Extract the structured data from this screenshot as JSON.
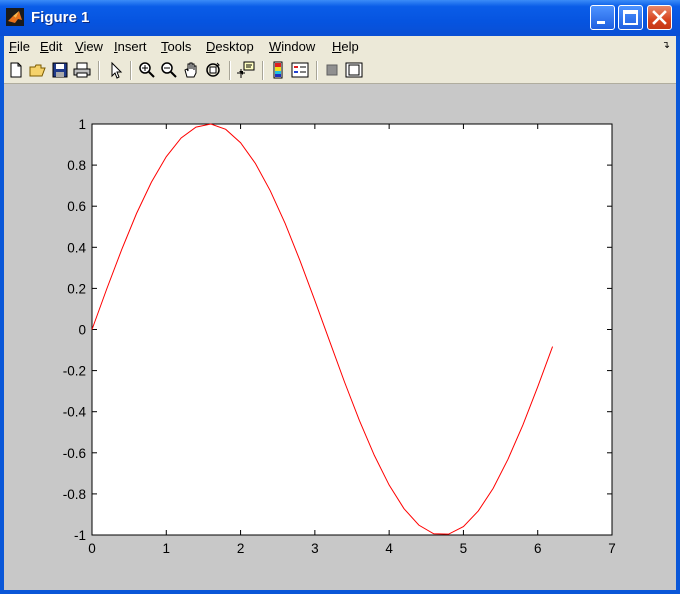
{
  "window": {
    "title": "Figure 1"
  },
  "menu": {
    "items": [
      "File",
      "Edit",
      "View",
      "Insert",
      "Tools",
      "Desktop",
      "Window",
      "Help"
    ],
    "shortcut_letters": [
      "F",
      "E",
      "V",
      "I",
      "T",
      "D",
      "W",
      "H"
    ]
  },
  "toolbar": {
    "buttons": [
      "new-figure-icon",
      "open-file-icon",
      "save-icon",
      "print-icon",
      "edit-plot-icon",
      "zoom-in-icon",
      "zoom-out-icon",
      "pan-icon",
      "rotate-3d-icon",
      "data-cursor-icon",
      "colorbar-icon",
      "legend-icon",
      "hide-plot-tools-icon",
      "show-plot-tools-icon"
    ]
  },
  "colors": {
    "line": "#ff0000",
    "figure_bg": "#c8c8c8",
    "axes_bg": "#ffffff",
    "title_bar": "#0a5de8"
  },
  "chart_data": {
    "type": "line",
    "title": "",
    "xlabel": "",
    "ylabel": "",
    "xlim": [
      0,
      7
    ],
    "ylim": [
      -1,
      1
    ],
    "xticks": [
      "0",
      "1",
      "2",
      "3",
      "4",
      "5",
      "6",
      "7"
    ],
    "yticks": [
      "1",
      "0.8",
      "0.6",
      "0.4",
      "0.2",
      "0",
      "-0.2",
      "-0.4",
      "-0.6",
      "-0.8",
      "-1"
    ],
    "grid": false,
    "series": [
      {
        "color": "#ff0000",
        "x": [
          0,
          0.2,
          0.4,
          0.6,
          0.8,
          1.0,
          1.2,
          1.4,
          1.6,
          1.8,
          2.0,
          2.2,
          2.4,
          2.6,
          2.8,
          3.0,
          3.2,
          3.4,
          3.6,
          3.8,
          4.0,
          4.2,
          4.4,
          4.6,
          4.8,
          5.0,
          5.2,
          5.4,
          5.6,
          5.8,
          6.0,
          6.2
        ],
        "y": [
          0,
          0.199,
          0.389,
          0.565,
          0.717,
          0.841,
          0.932,
          0.985,
          1.0,
          0.974,
          0.909,
          0.808,
          0.675,
          0.516,
          0.335,
          0.141,
          -0.058,
          -0.256,
          -0.443,
          -0.612,
          -0.757,
          -0.872,
          -0.952,
          -0.994,
          -0.996,
          -0.959,
          -0.883,
          -0.773,
          -0.631,
          -0.465,
          -0.279,
          -0.083
        ]
      }
    ]
  }
}
